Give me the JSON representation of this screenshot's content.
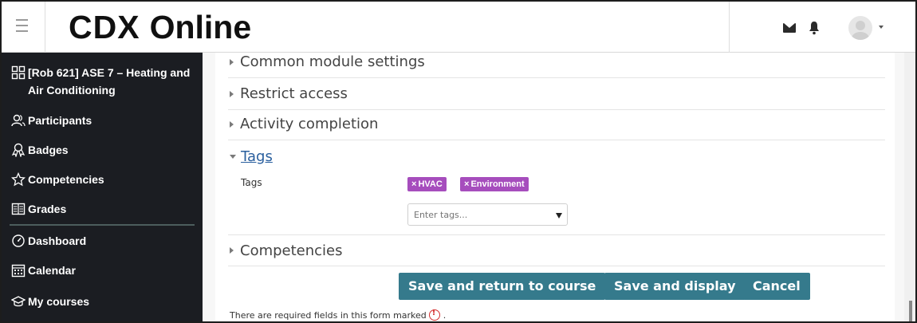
{
  "navbar": {
    "brand_left": "CDX",
    "brand_right": "Online",
    "icons": [
      "hamburger-icon",
      "mail-icon",
      "bell-icon",
      "avatar-icon",
      "caret-down-icon"
    ]
  },
  "sidebar": {
    "items": [
      {
        "label": "[Rob 621] ASE 7 – Heating and Air Conditioning",
        "icon": "course-grid-icon"
      },
      {
        "label": "Participants",
        "icon": "participants-icon"
      },
      {
        "label": "Badges",
        "icon": "badge-icon"
      },
      {
        "label": "Competencies",
        "icon": "star-icon"
      },
      {
        "label": "Grades",
        "icon": "grades-icon"
      },
      {
        "label": "Dashboard",
        "icon": "dashboard-icon"
      },
      {
        "label": "Calendar",
        "icon": "calendar-icon"
      },
      {
        "label": "My courses",
        "icon": "my-courses-icon"
      }
    ]
  },
  "sections": {
    "common_module_settings": "Common module settings",
    "restrict_access": "Restrict access",
    "activity_completion": "Activity completion",
    "tags": "Tags",
    "competencies": "Competencies"
  },
  "tags_field": {
    "label": "Tags",
    "chips": [
      "HVAC",
      "Environment"
    ],
    "chip_remove_symbol": "×",
    "placeholder": "Enter tags..."
  },
  "buttons": {
    "save_return": "Save and return to course",
    "save_display": "Save and display",
    "cancel": "Cancel"
  },
  "footer_note": {
    "text": "There are required fields in this form marked",
    "end": "."
  },
  "colors": {
    "sidebar_bg": "#1b1d22",
    "button_bg": "#357a8c",
    "tag_bg": "#a64dbd",
    "tags_heading": "#2a5f9e",
    "required_icon": "#d32f2f"
  }
}
